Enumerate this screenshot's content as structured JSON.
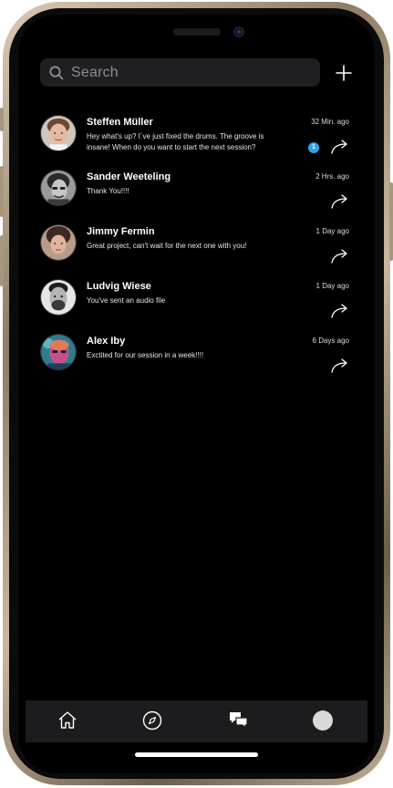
{
  "search": {
    "placeholder": "Search"
  },
  "conversations": [
    {
      "name": "Steffen Müller",
      "message": "Hey what's up? I´ve just fixed the drums. The groove is insane! When do you want to start the next session?",
      "time": "32 Min. ago",
      "unread": "1"
    },
    {
      "name": "Sander Weeteling",
      "message": "Thank You!!!!",
      "time": "2 Hrs. ago"
    },
    {
      "name": "Jimmy Fermin",
      "message": "Great project, can't wait for the next one with you!",
      "time": "1 Day ago"
    },
    {
      "name": "Ludvig Wiese",
      "message": "You've sent an audio file",
      "time": "1 Day ago"
    },
    {
      "name": "Alex Iby",
      "message": "Exctited for our session in a week!!!!",
      "time": "6 Days ago"
    }
  ],
  "tabs": [
    "home-icon",
    "compass-icon",
    "chat-icon",
    "profile-avatar-icon"
  ],
  "colors": {
    "background": "#000000",
    "search_bg": "#1f1f21",
    "badge": "#2aa3f0",
    "tabbar": "#1c1c1e"
  }
}
